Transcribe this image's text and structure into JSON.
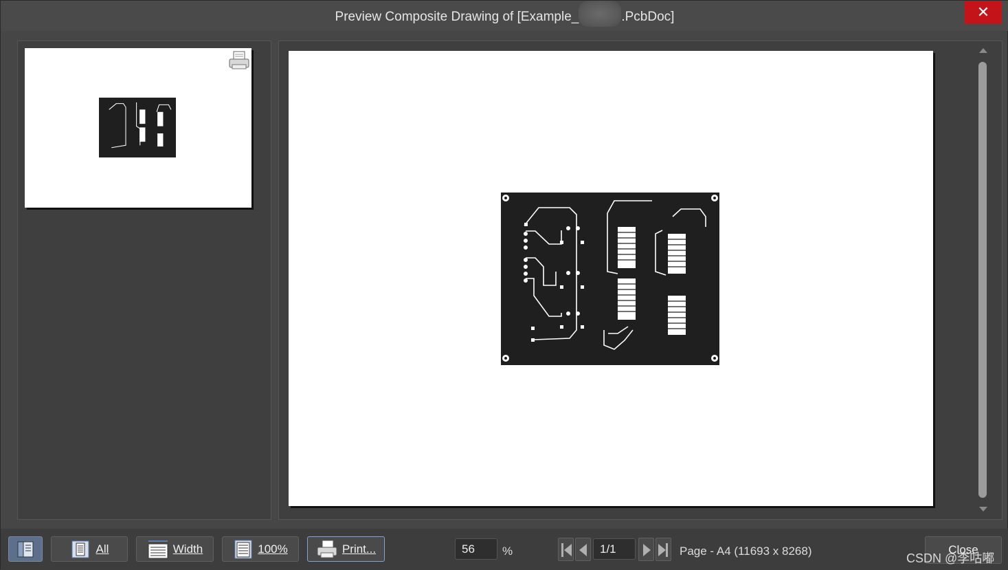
{
  "window": {
    "title_prefix": "Preview Composite Drawing of [Example_",
    "title_suffix": ".PcbDoc]",
    "close_glyph": "✕"
  },
  "toolbar": {
    "all_label": "All",
    "width_label": "Width",
    "zoom100_label": "100%",
    "print_label": "Print...",
    "zoom_value": "56",
    "zoom_unit": "%",
    "page_value": "1/1",
    "page_info": "Page - A4 (11693 x 8268)",
    "close_label": "Close"
  },
  "watermark": "CSDN @李咕嘟",
  "icons": {
    "thumbnail_toggle": "panel-toggle-icon",
    "all": "page-fit-all-icon",
    "width": "page-fit-width-icon",
    "zoom100": "page-actual-size-icon",
    "print": "printer-icon",
    "nav_first": "first-page-icon",
    "nav_prev": "previous-page-icon",
    "nav_next": "next-page-icon",
    "nav_last": "last-page-icon"
  },
  "colors": {
    "window_bg": "#464646",
    "close_red": "#c4141a",
    "board_bg": "#1f1f1f",
    "trace": "#ffffff"
  }
}
